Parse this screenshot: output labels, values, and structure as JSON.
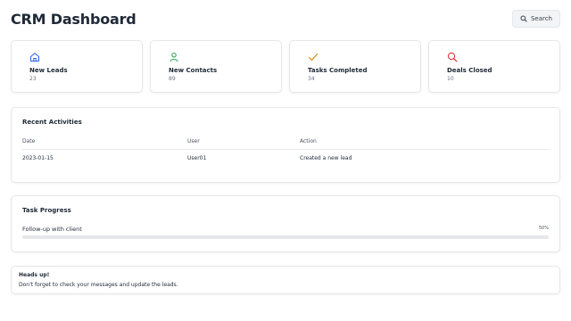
{
  "header": {
    "title": "CRM Dashboard",
    "search_label": "Search",
    "search_icon": "search-icon"
  },
  "stats": [
    {
      "label": "New Leads",
      "value": "23",
      "icon": "home-icon",
      "color": "#2563eb"
    },
    {
      "label": "New Contacts",
      "value": "89",
      "icon": "user-icon",
      "color": "#16a34a"
    },
    {
      "label": "Tasks Completed",
      "value": "34",
      "icon": "check-icon",
      "color": "#ca8a04"
    },
    {
      "label": "Deals Closed",
      "value": "10",
      "icon": "search-icon",
      "color": "#dc2626"
    }
  ],
  "activities": {
    "title": "Recent Activities",
    "columns": [
      "Date",
      "User",
      "Action"
    ],
    "rows": [
      [
        "2023-01-15",
        "User01",
        "Created a new lead"
      ]
    ]
  },
  "progress": {
    "title": "Task Progress",
    "task": "Follow-up with client",
    "percent_label": "50%",
    "percent": 50
  },
  "alert": {
    "title": "Heads up!",
    "message": "Don't forget to check your messages and update the leads."
  }
}
